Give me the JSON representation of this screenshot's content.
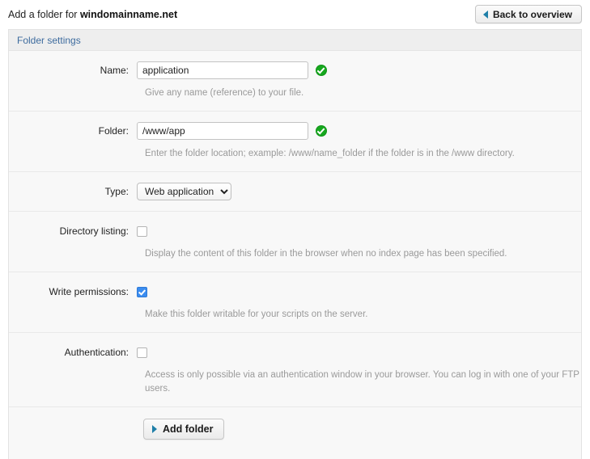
{
  "header": {
    "title_prefix": "Add a folder for ",
    "domain": "windomainname.net",
    "back_button": "Back to overview",
    "back_icon": "triangle-left-icon"
  },
  "panel": {
    "section_title": "Folder settings"
  },
  "form": {
    "name": {
      "label": "Name:",
      "value": "application",
      "placeholder": "",
      "help": "Give any name (reference) to your file.",
      "valid_icon": "green-check-icon"
    },
    "folder": {
      "label": "Folder:",
      "value": "/www/app",
      "placeholder": "",
      "help": "Enter the folder location; example: /www/name_folder if the folder is in the /www directory.",
      "valid_icon": "green-check-icon"
    },
    "type": {
      "label": "Type:",
      "selected": "Web application",
      "options": [
        "Web application"
      ]
    },
    "directory_listing": {
      "label": "Directory listing:",
      "checked": false,
      "help": "Display the content of this folder in the browser when no index page has been specified."
    },
    "write_permissions": {
      "label": "Write permissions:",
      "checked": true,
      "help": "Make this folder writable for your scripts on the server."
    },
    "authentication": {
      "label": "Authentication:",
      "checked": false,
      "help": "Access is only possible via an authentication window in your browser. You can log in with one of your FTP users."
    },
    "submit": {
      "label": "Add folder",
      "icon": "triangle-right-icon"
    }
  },
  "colors": {
    "accent_blue": "#3d6b9e",
    "arrow_blue": "#1f7fa8",
    "success_green": "#16a81e",
    "checkbox_blue": "#3b8df0",
    "panel_bg": "#f8f8f8",
    "panel_header_bg": "#eeeeee"
  }
}
